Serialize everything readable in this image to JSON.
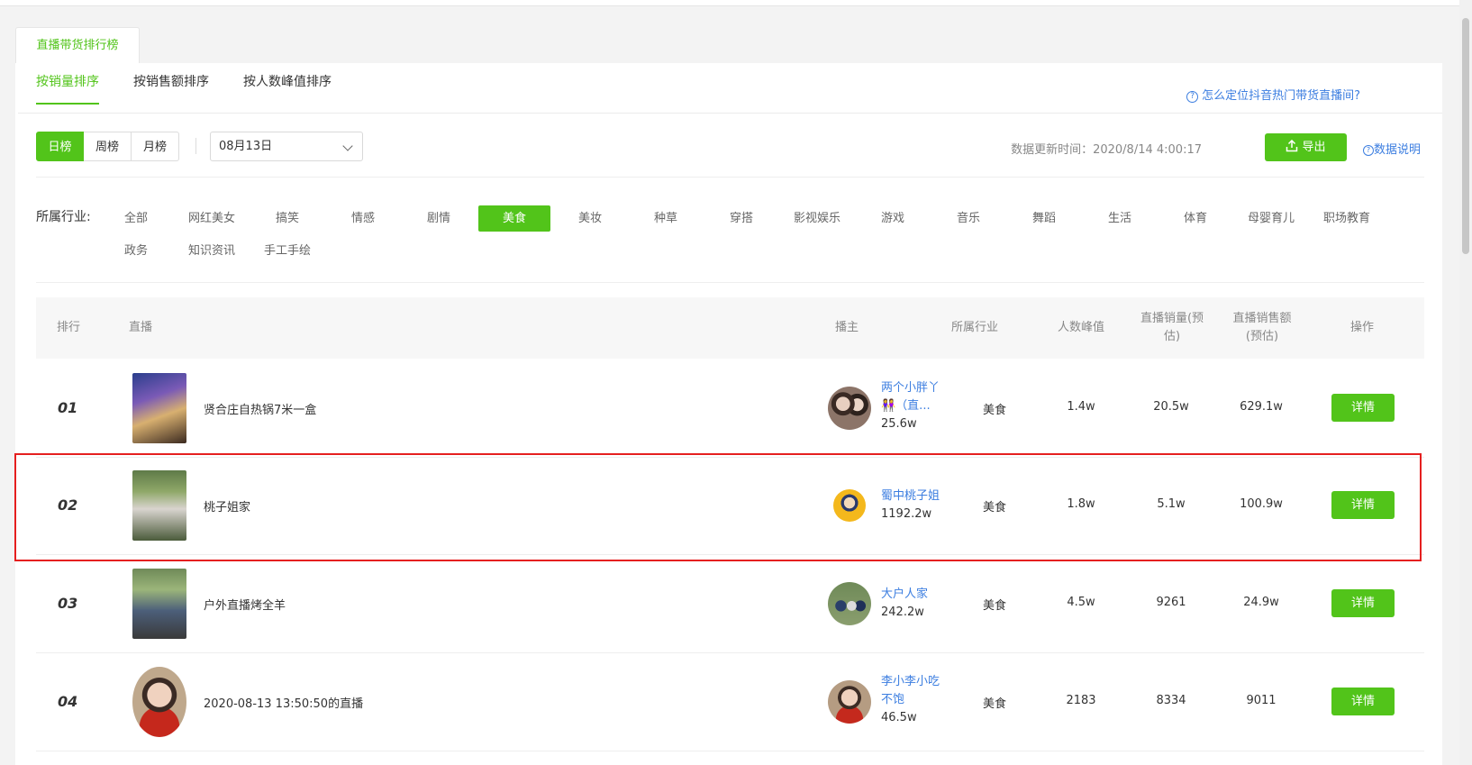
{
  "main_tab": "直播带货排行榜",
  "sort_tabs": [
    "按销量排序",
    "按销售额排序",
    "按人数峰值排序"
  ],
  "help_link": "怎么定位抖音热门带货直播间?",
  "periods": [
    "日榜",
    "周榜",
    "月榜"
  ],
  "date_value": "08月13日",
  "update_time": "数据更新时间：2020/8/14 4:00:17",
  "export_label": "导出",
  "data_note": "数据说明",
  "industry_label": "所属行业:",
  "industries_row1": [
    "全部",
    "网红美女",
    "搞笑",
    "情感",
    "剧情",
    "美食",
    "美妆",
    "种草",
    "穿搭",
    "影视娱乐",
    "游戏",
    "音乐",
    "舞蹈",
    "生活",
    "体育",
    "母婴育儿",
    "职场教育"
  ],
  "industries_row2": [
    "政务",
    "知识资讯",
    "手工手绘"
  ],
  "headers": {
    "rank": "排行",
    "live": "直播",
    "anchor": "播主",
    "industry": "所属行业",
    "peak": "人数峰值",
    "sales1": "直播销量(预",
    "sales2": "估)",
    "revenue1": "直播销售额",
    "revenue2": "(预估)",
    "action": "操作"
  },
  "detail_label": "详情",
  "rows": [
    {
      "rank": "01",
      "title": "贤合庄自热锅7米一盒",
      "anchor1": "两个小胖丫",
      "anchor2": "👭（直...",
      "fans": "25.6w",
      "industry": "美食",
      "peak": "1.4w",
      "sales": "20.5w",
      "revenue": "629.1w"
    },
    {
      "rank": "02",
      "title": "桃子姐家",
      "anchor1": "蜀中桃子姐",
      "anchor2": "",
      "fans": "1192.2w",
      "industry": "美食",
      "peak": "1.8w",
      "sales": "5.1w",
      "revenue": "100.9w"
    },
    {
      "rank": "03",
      "title": "户外直播烤全羊",
      "anchor1": "大户人家",
      "anchor2": "",
      "fans": "242.2w",
      "industry": "美食",
      "peak": "4.5w",
      "sales": "9261",
      "revenue": "24.9w"
    },
    {
      "rank": "04",
      "title": "2020-08-13 13:50:50的直播",
      "anchor1": "李小李小吃",
      "anchor2": "不饱",
      "fans": "46.5w",
      "industry": "美食",
      "peak": "2183",
      "sales": "8334",
      "revenue": "9011"
    }
  ],
  "colors": {
    "accent": "#52c41a",
    "link": "#3c7ee0",
    "highlight": "#e51f1f"
  }
}
